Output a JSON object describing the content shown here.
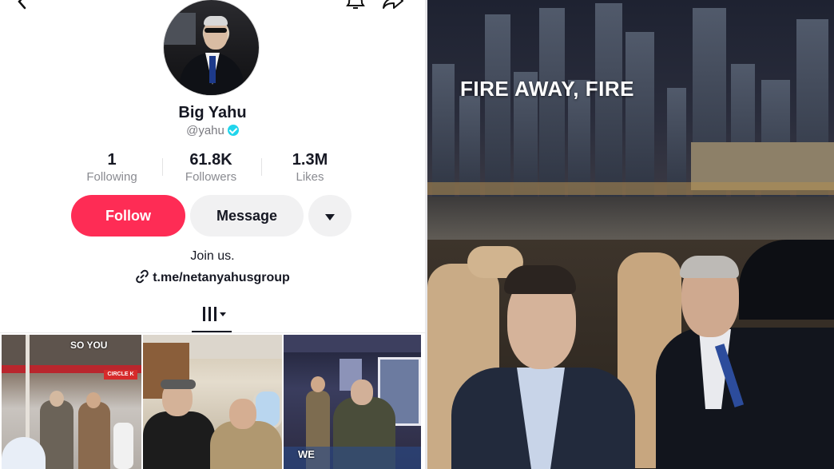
{
  "profile": {
    "display_name": "Big Yahu",
    "handle": "@yahu",
    "stats": [
      {
        "value": "1",
        "label": "Following"
      },
      {
        "value": "61.8K",
        "label": "Followers"
      },
      {
        "value": "1.3M",
        "label": "Likes"
      }
    ],
    "bio": "Join us.",
    "bio_link": "t.me/netanyahusgroup"
  },
  "actions": {
    "follow_label": "Follow",
    "message_label": "Message"
  },
  "videos": [
    {
      "caption": "SO YOU"
    },
    {
      "caption": ""
    },
    {
      "caption": "WE"
    }
  ],
  "thumb1_signs": {
    "circle_k": "CIRCLE K"
  },
  "right_image": {
    "caption": "FIRE AWAY, FIRE"
  },
  "colors": {
    "follow": "#fe2c55",
    "verified": "#20d5ec"
  }
}
